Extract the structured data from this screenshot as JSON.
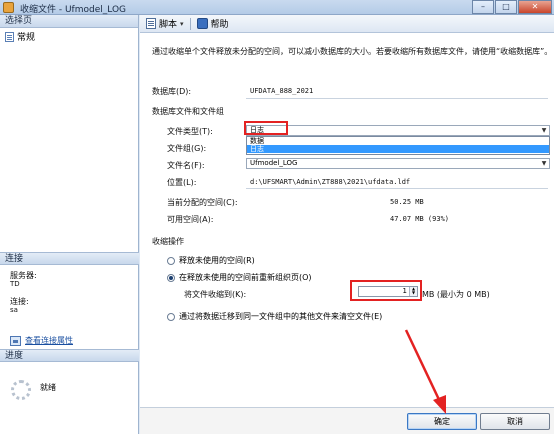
{
  "window": {
    "title": "收缩文件 - Ufmodel_LOG",
    "minimize": "–",
    "maximize": "□",
    "close": "✕"
  },
  "left": {
    "select_page_header": "选择页",
    "pages": [
      "常规"
    ],
    "connection_header": "连接",
    "server_label": "服务器:",
    "server_value": "TD",
    "connection_label": "连接:",
    "connection_value": "sa",
    "view_connection_link": "查看连接属性",
    "progress_header": "进度",
    "progress_status": "就绪"
  },
  "toolbar": {
    "script_label": "脚本",
    "script_caret": "▾",
    "help_label": "帮助"
  },
  "main": {
    "description": "通过收缩单个文件释放未分配的空间，可以减小数据库的大小。若要收缩所有数据库文件，请使用“收缩数据库”。",
    "database_label": "数据库(D):",
    "database_value": "UFDATA_888_2021",
    "files_group_title": "数据库文件和文件组",
    "file_type_label": "文件类型(T):",
    "file_type_value": "日志",
    "file_type_options": [
      "数据",
      "日志"
    ],
    "file_type_selected_index": 1,
    "filegroup_label": "文件组(G):",
    "filegroup_value": "",
    "file_name_label": "文件名(F):",
    "file_name_value": "Ufmodel_LOG",
    "location_label": "位置(L):",
    "location_value": "d:\\UFSMART\\Admin\\ZT888\\2021\\ufdata.ldf",
    "allocated_label": "当前分配的空间(C):",
    "allocated_value": "50.25 MB",
    "free_label": "可用空间(A):",
    "free_value": "47.07 MB (93%)",
    "shrink_title": "收缩操作",
    "option_release": "释放未使用的空间(R)",
    "option_reorganize": "在释放未使用的空间前重新组织页(O)",
    "shrink_to_label": "将文件收缩到(K):",
    "shrink_to_value": "1",
    "shrink_to_unit": "MB (最小为 0 MB)",
    "option_empty": "通过将数据迁移到同一文件组中的其他文件来清空文件(E)",
    "selected_option": "reorganize"
  },
  "buttons": {
    "ok": "确定",
    "cancel": "取消"
  },
  "colors": {
    "annotation_red": "#e32222",
    "selection_blue": "#3399ff"
  }
}
